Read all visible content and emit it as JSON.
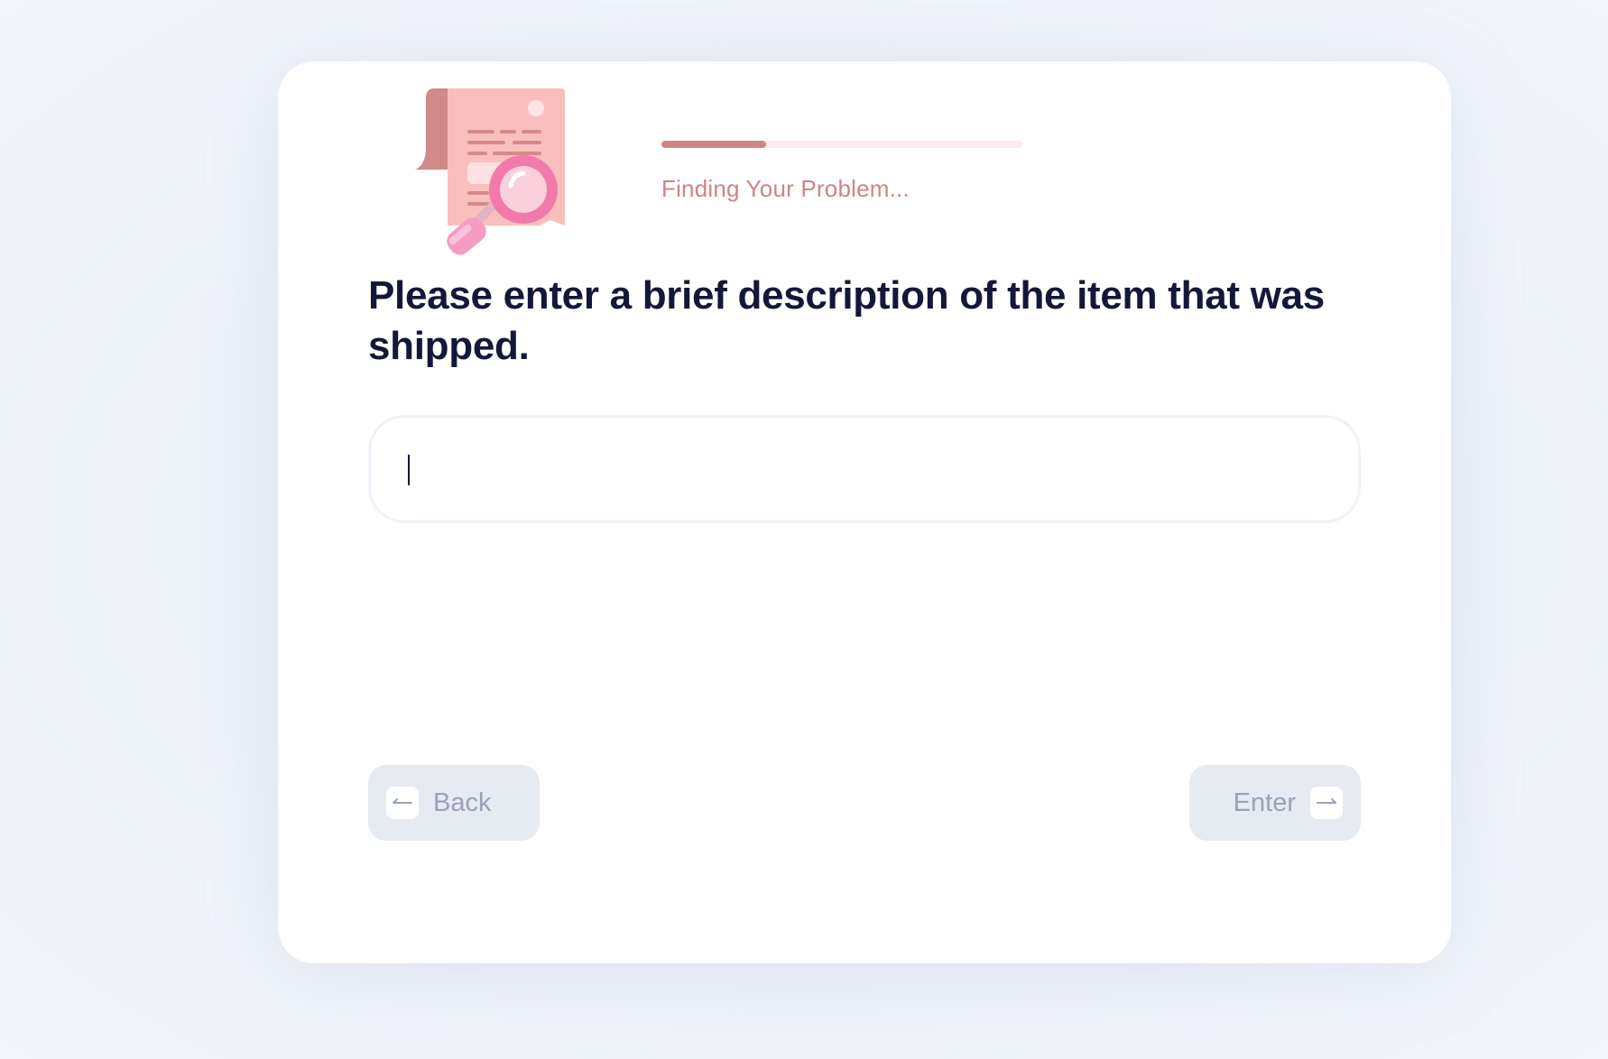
{
  "progress": {
    "value": 0.29,
    "label": "Finding Your Problem..."
  },
  "question": {
    "text": "Please enter a brief description of the item that was shipped."
  },
  "answer": {
    "value": "",
    "placeholder": ""
  },
  "navigation": {
    "back_label": "Back",
    "enter_label": "Enter",
    "back_icon": "arrow-left-icon",
    "enter_icon": "arrow-right-icon"
  },
  "illustration": {
    "icon": "document-search-icon"
  },
  "colors": {
    "accent": "#cf8485",
    "accent_light": "#fcebeb",
    "heading": "#141838",
    "button_bg": "#e6eaf1",
    "button_text": "#97a3b8",
    "magnifier": "#f27aab"
  }
}
